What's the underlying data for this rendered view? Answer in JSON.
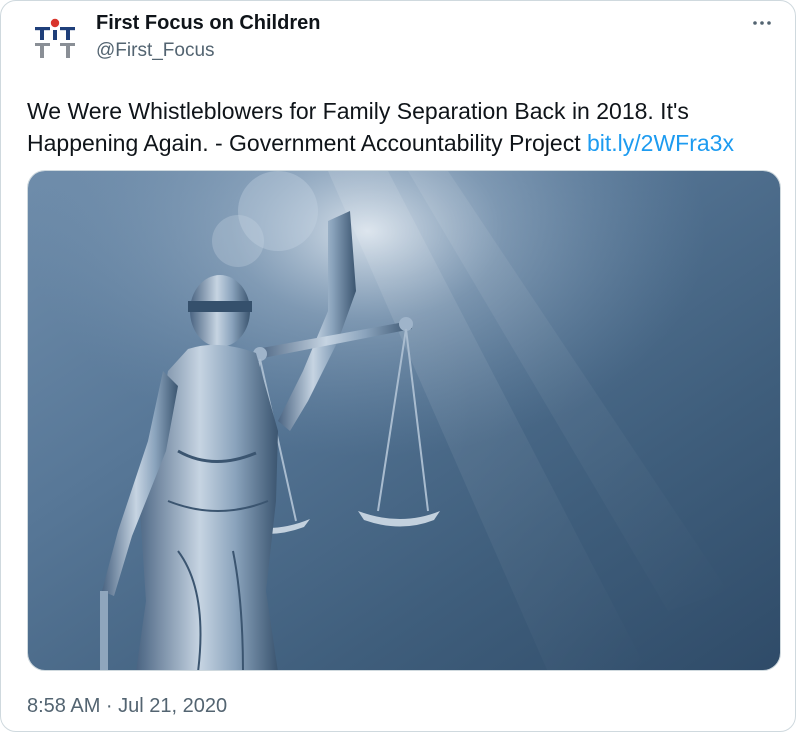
{
  "author": {
    "name": "First Focus on Children",
    "handle": "@First_Focus",
    "avatar_icon": "first-focus-logo-icon",
    "brand_colors": [
      "#1f3f7a",
      "#d9352c"
    ]
  },
  "more_icon": "ellipsis-icon",
  "tweet": {
    "text": "We Were Whistleblowers for Family Separation Back in 2018. It's Happening Again. - Government Accountability Project ",
    "link": "bit.ly/2WFra3x",
    "link_color": "#1d9bf0"
  },
  "media": {
    "icon": "lady-justice-scales-image",
    "tint": "#3e5a76"
  },
  "timestamp": "8:58 AM · Jul 21, 2020"
}
